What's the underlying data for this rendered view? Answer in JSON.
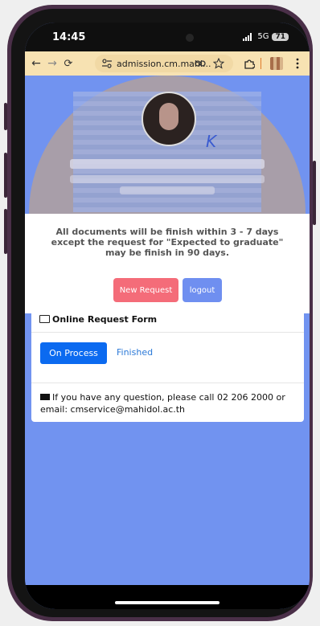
{
  "status_bar": {
    "time": "14:45",
    "signal": "5G",
    "battery": "71"
  },
  "browser": {
    "url": "admission.cm.mahi...",
    "back_icon": "arrow-left-icon",
    "forward_icon": "arrow-right-icon",
    "reload_icon": "reload-icon",
    "menu_icon": "kebab-icon"
  },
  "hero": {
    "signature": "K"
  },
  "notice": {
    "text": "All documents will be finish within 3 - 7 days except the request for \"Expected to graduate\" may be finish in 90 days.",
    "new_request_label": "New Request",
    "logout_label": "logout"
  },
  "colors": {
    "background": "#7193f0",
    "new_request": "#f46c79",
    "logout": "#6f8ff0",
    "primary": "#0b6af0",
    "link": "#2b79d8"
  },
  "form": {
    "title": "Online Request Form",
    "tabs": [
      {
        "label": "On Process",
        "active": true
      },
      {
        "label": "Finished",
        "active": false
      }
    ],
    "contact": "If you have any question, please call 02 206 2000 or email: cmservice@mahidol.ac.th"
  }
}
